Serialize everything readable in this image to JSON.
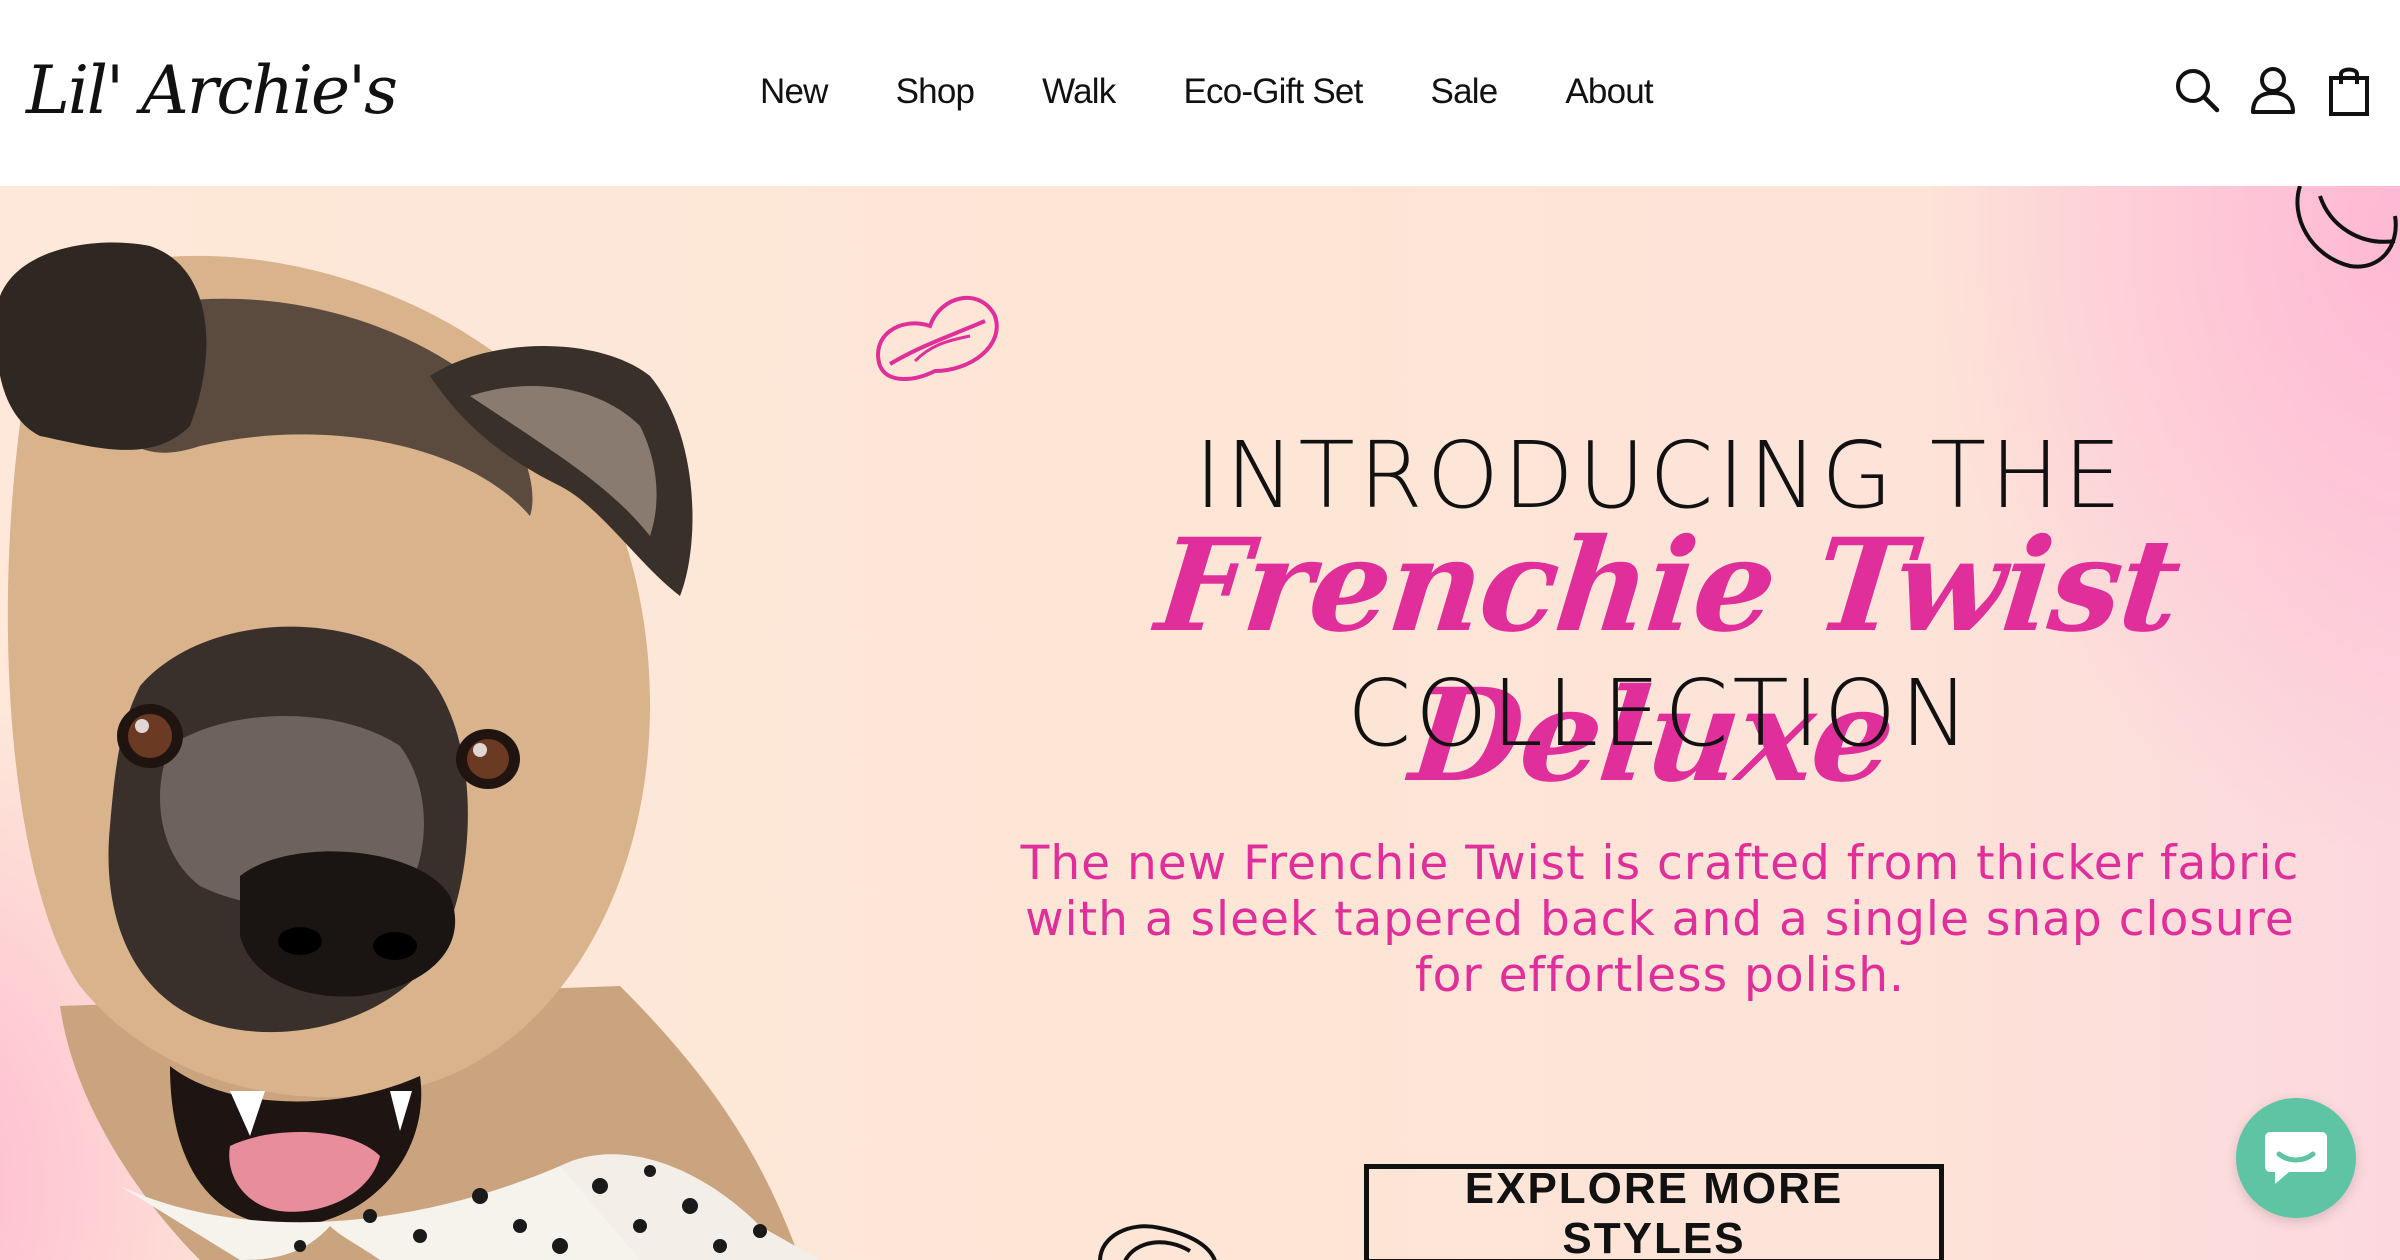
{
  "header": {
    "logo_text": "Lil' Archie's",
    "nav": [
      {
        "label": "New"
      },
      {
        "label": "Shop"
      },
      {
        "label": "Walk"
      },
      {
        "label": "Eco-Gift Set"
      },
      {
        "label": "Sale"
      },
      {
        "label": "About"
      }
    ],
    "icons": [
      "search-icon",
      "account-icon",
      "cart-icon"
    ]
  },
  "hero": {
    "title_top": "INTRODUCING THE",
    "title_script": "Frenchie Twist Deluxe",
    "title_bottom": "COLLECTION",
    "description": "The new Frenchie Twist is crafted from thicker fabric with a sleek tapered back and a single snap closure for effortless polish.",
    "cta_label": "EXPLORE MORE STYLES",
    "image": "dog-with-polka-dot-bandana"
  },
  "chat": {
    "icon": "chat-icon"
  },
  "colors": {
    "accent_pink": "#e02e9a",
    "chat_green": "#5fc4a3",
    "hero_bg": "#fde6d6",
    "text": "#111111"
  }
}
